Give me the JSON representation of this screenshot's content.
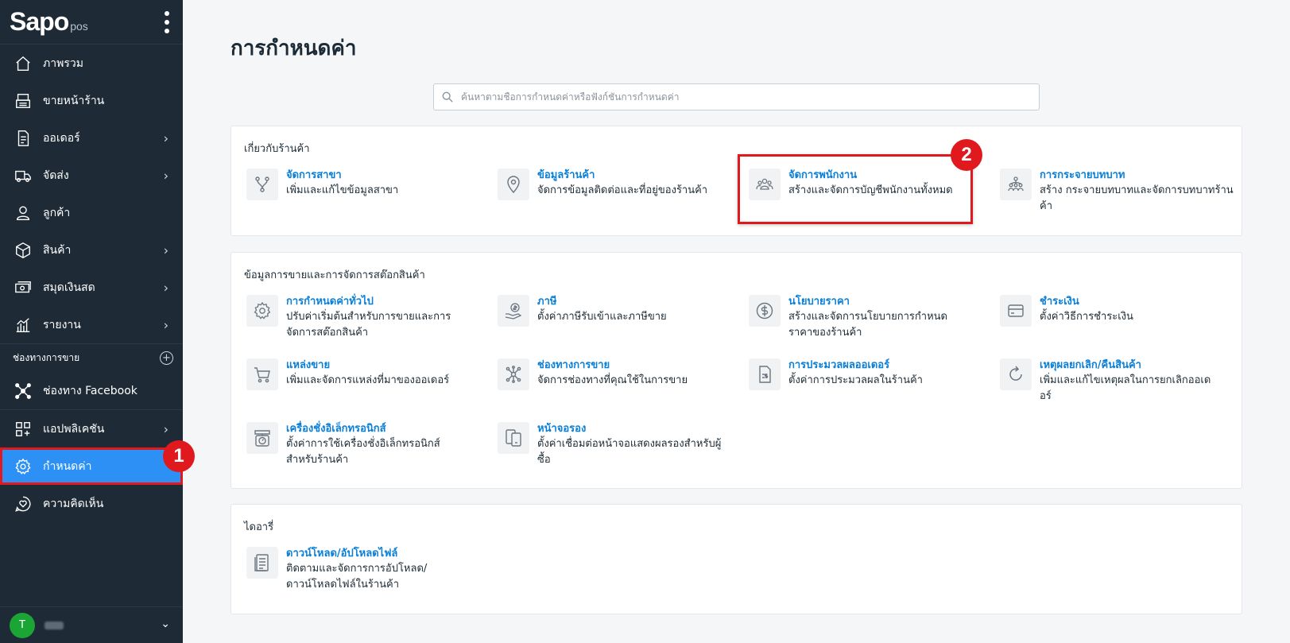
{
  "sidebar": {
    "logo_main": "Sapo",
    "logo_sub": "pos",
    "items": [
      {
        "label": "ภาพรวม",
        "icon": "home-icon"
      },
      {
        "label": "ขายหน้าร้าน",
        "icon": "pos-icon"
      },
      {
        "label": "ออเดอร์",
        "icon": "order-icon"
      },
      {
        "label": "จัดส่ง",
        "icon": "truck-icon"
      },
      {
        "label": "ลูกค้า",
        "icon": "user-icon"
      },
      {
        "label": "สินค้า",
        "icon": "box-icon"
      },
      {
        "label": "สมุดเงินสด",
        "icon": "cash-icon"
      },
      {
        "label": "รายงาน",
        "icon": "report-icon"
      }
    ],
    "section_label": "ช่องทางการขาย",
    "facebook_label": "ช่องทาง Facebook",
    "apps_label": "แอปพลิเคชัน",
    "settings_label": "กำหนดค่า",
    "feedback_label": "ความคิดเห็น",
    "user_initial": "T"
  },
  "markers": {
    "one": "1",
    "two": "2"
  },
  "main": {
    "title": "การกำหนดค่า",
    "search_placeholder": "ค้นหาตามชื่อการกำหนดค่าหรือฟังก์ชันการกำหนดค่า",
    "sections": [
      {
        "title": "เกี่ยวกับร้านค้า",
        "items": [
          {
            "title": "จัดการสาขา",
            "desc": "เพิ่มและแก้ไขข้อมูลสาขา",
            "icon": "branch-icon"
          },
          {
            "title": "ข้อมูลร้านค้า",
            "desc": "จัดการข้อมูลติดต่อและที่อยู่ของร้านค้า",
            "icon": "location-pin-icon"
          },
          {
            "title": "จัดการพนักงาน",
            "desc": "สร้างและจัดการบัญชีพนักงานทั้งหมด",
            "icon": "staff-group-icon"
          },
          {
            "title": "การกระจายบทบาท",
            "desc": "สร้าง กระจายบทบาทและจัดการบทบาทร้านค้า",
            "icon": "role-hierarchy-icon"
          }
        ]
      },
      {
        "title": "ข้อมูลการขายและการจัดการสต๊อกสินค้า",
        "items": [
          {
            "title": "การกำหนดค่าทั่วไป",
            "desc": "ปรับค่าเริ่มต้นสำหรับการขายและการจัดการสต๊อกสินค้า",
            "icon": "gear-icon"
          },
          {
            "title": "ภาษี",
            "desc": "ตั้งค่าภาษีรับเข้าและภาษีขาย",
            "icon": "tax-hand-icon"
          },
          {
            "title": "นโยบายราคา",
            "desc": "สร้างและจัดการนโยบายการกำหนดราคาของร้านค้า",
            "icon": "dollar-circle-icon"
          },
          {
            "title": "ชำระเงิน",
            "desc": "ตั้งค่าวิธีการชำระเงิน",
            "icon": "card-icon"
          },
          {
            "title": "แหล่งขาย",
            "desc": "เพิ่มและจัดการแหล่งที่มาของออเดอร์",
            "icon": "cart-icon"
          },
          {
            "title": "ช่องทางการขาย",
            "desc": "จัดการช่องทางที่คุณใช้ในการขาย",
            "icon": "channel-hub-icon"
          },
          {
            "title": "การประมวลผลออเดอร์",
            "desc": "ตั้งค่าการประมวลผลในร้านค้า",
            "icon": "order-doc-icon"
          },
          {
            "title": "เหตุผลยกเลิก/คืนสินค้า",
            "desc": "เพิ่มและแก้ไขเหตุผลในการยกเลิกออเดอร์",
            "icon": "refresh-icon"
          },
          {
            "title": "เครื่องชั่งอิเล็กทรอนิกส์",
            "desc": "ตั้งค่าการใช้เครื่องชั่งอิเล็กทรอนิกส์สำหรับร้านค้า",
            "icon": "scale-icon"
          },
          {
            "title": "หน้าจอรอง",
            "desc": "ตั้งค่าเชื่อมต่อหน้าจอแสดงผลรองสำหรับผู้ซื้อ",
            "icon": "screens-icon"
          }
        ]
      },
      {
        "title": "ไดอารี่",
        "items": [
          {
            "title": "ดาวน์โหลด/อัปโหลดไฟล์",
            "desc": "ติดตามและจัดการการอัปโหลด/ดาวน์โหลดไฟล์ในร้านค้า",
            "icon": "file-list-icon"
          }
        ]
      }
    ]
  }
}
